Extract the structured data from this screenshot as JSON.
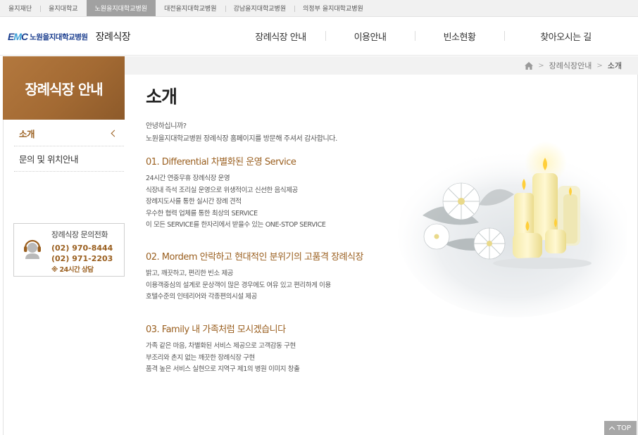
{
  "topbar": {
    "items": [
      "을지재단",
      "을지대학교",
      "노원을지대학교병원",
      "대전을지대학교병원",
      "강남을지대학교병원",
      "의정부 을지대학교병원"
    ],
    "active_index": 2
  },
  "header": {
    "logo_mark": "EMC",
    "logo_name": "노원을지대학교병원",
    "logo_sub": "장례식장",
    "nav": [
      "장례식장 안내",
      "이용안내",
      "빈소현황",
      "찾아오시는 길"
    ]
  },
  "breadcrumb": {
    "home_icon": "home-icon",
    "items": [
      "장례식장안내",
      "소개"
    ]
  },
  "sidebar": {
    "title": "장례식장 안내",
    "items": [
      {
        "label": "소개",
        "active": true
      },
      {
        "label": "문의 및 위치안내",
        "active": false
      }
    ],
    "contact": {
      "icon": "headset-icon",
      "title": "장례식장 문의전화",
      "phone1": "(02) 970-8444",
      "phone2": "(02) 971-2203",
      "hours": "※ 24시간 상담"
    }
  },
  "main": {
    "title": "소개",
    "intro": [
      "안녕하십니까?",
      "노원을지대학교병원 장례식장 홈페이지를 방문해 주셔서 감사합니다."
    ],
    "sections": [
      {
        "heading": "01. Differential 차별화된 운영 Service",
        "lines": [
          "24시간 연중무휴 장례식장 운영",
          "식장내 즉석 조리실 운영으로 위생적이고 신선한 음식제공",
          "장례지도사를 통한 실시간 장례 견적",
          "우수한 협력 업체를 통한 최상의 SERVICE",
          "이 모든 SERVICE를 한자리에서 받을수 있는 ONE-STOP SERVICE"
        ]
      },
      {
        "heading": "02. Mordem 안락하고 현대적인 분위기의 고품격 장례식장",
        "lines": [
          "밝고, 깨끗하고, 편리한 빈소 제공",
          "이용객중심의 설계로 문상객이 많은 경우에도 여유 있고 편리하게 이용",
          "호텔수준의 인테리어와 각종편의시설 제공"
        ]
      },
      {
        "heading": "03. Family 내 가족처럼 모시겠습니다",
        "lines": [
          "가족 같은 마음, 차별화된 서비스 제공으로 고객감동 구현",
          "부조리와 촌지 없는 깨끗한 장례식장 구현",
          "품격 높은 서비스 실현으로 지역구 제1의 병원 이미지 창출"
        ]
      }
    ]
  },
  "top_button": "TOP",
  "colors": {
    "accent": "#9a5f1f",
    "sidebar_header": "#a36a33",
    "topbar_active": "#a1a1a1",
    "brand_blue": "#1b3e8f"
  }
}
